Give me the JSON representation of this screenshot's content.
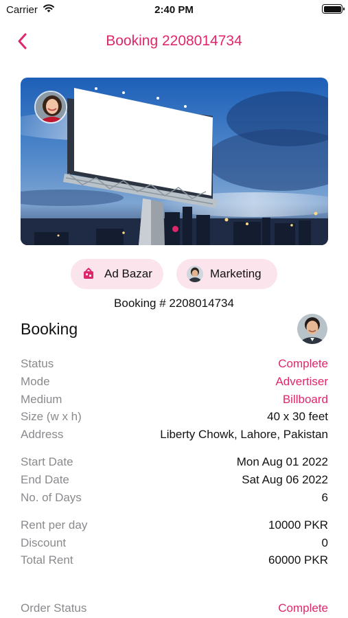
{
  "status_bar": {
    "carrier": "Carrier",
    "time": "2:40 PM"
  },
  "nav": {
    "title": "Booking 2208014734"
  },
  "chips": [
    {
      "label": "Ad Bazar",
      "icon": "ad-bazar-logo-icon"
    },
    {
      "label": "Marketing",
      "icon": "marketing-avatar-icon"
    }
  ],
  "booking_number": "Booking # 2208014734",
  "section": {
    "title": "Booking"
  },
  "details": {
    "status": {
      "label": "Status",
      "value": "Complete"
    },
    "mode": {
      "label": "Mode",
      "value": "Advertiser"
    },
    "medium": {
      "label": "Medium",
      "value": "Billboard"
    },
    "size": {
      "label": "Size (w x h)",
      "value": "40 x 30 feet"
    },
    "address": {
      "label": "Address",
      "value": "Liberty Chowk, Lahore, Pakistan"
    },
    "start_date": {
      "label": "Start Date",
      "value": "Mon Aug 01 2022"
    },
    "end_date": {
      "label": "End Date",
      "value": "Sat Aug 06 2022"
    },
    "days": {
      "label": "No. of Days",
      "value": "6"
    },
    "rent_per_day": {
      "label": "Rent per day",
      "value": "10000 PKR"
    },
    "discount": {
      "label": "Discount",
      "value": "0"
    },
    "total_rent": {
      "label": "Total Rent",
      "value": "60000 PKR"
    },
    "order_status": {
      "label": "Order Status",
      "value": "Complete"
    }
  },
  "colors": {
    "accent": "#e0266b",
    "chip_bg": "#fbe4ec",
    "label_gray": "#8a8a8e"
  }
}
